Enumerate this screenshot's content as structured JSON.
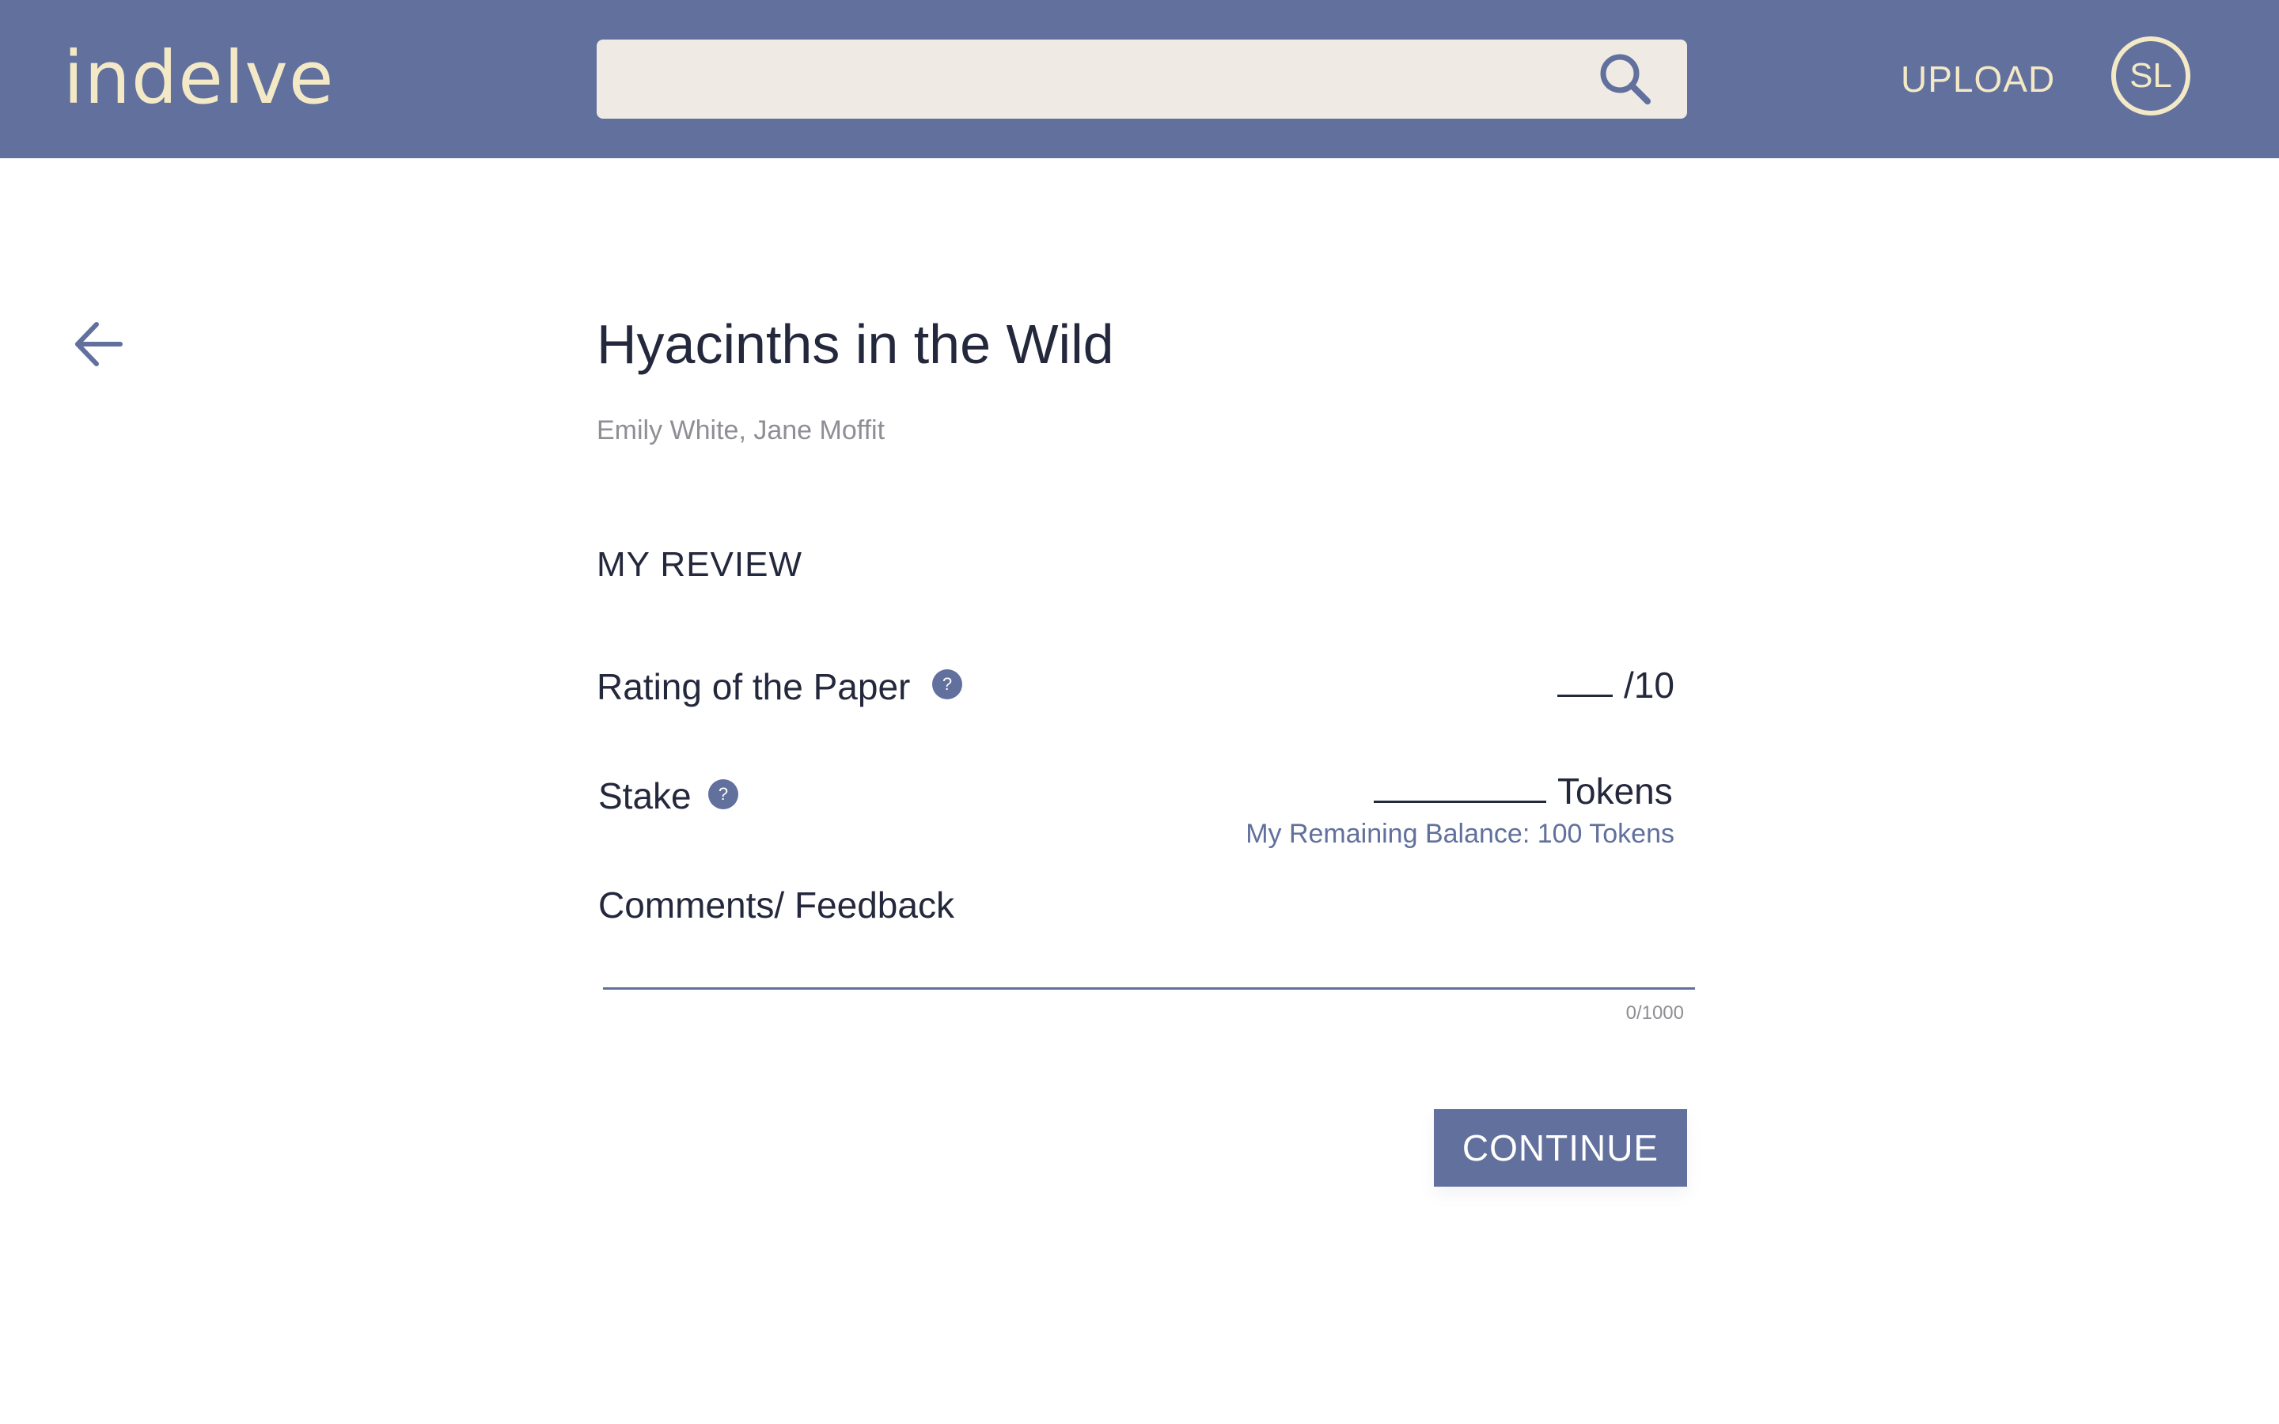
{
  "header": {
    "logo_text": "indelve",
    "search": {
      "value": "",
      "placeholder": "",
      "icon": "search-icon"
    },
    "upload_label": "UPLOAD",
    "avatar_initials": "SL"
  },
  "colors": {
    "brand": "#61709C",
    "logo_text": "#F3E9C6",
    "search_background": "#EFEBE4",
    "title_text": "#24283C",
    "muted_text": "#8E8E94"
  },
  "navigation": {
    "back_icon": "arrow-left-icon"
  },
  "paper": {
    "title": "Hyacinths in the Wild",
    "authors": "Emily White, Jane Moffit"
  },
  "review": {
    "heading": "MY REVIEW",
    "rating": {
      "label": "Rating of the Paper",
      "help_glyph": "?",
      "value": "",
      "max_text": "/10"
    },
    "stake": {
      "label": "Stake",
      "help_glyph": "?",
      "value": "",
      "unit": "Tokens",
      "balance_text": "My Remaining Balance: 100 Tokens"
    },
    "comments": {
      "label": "Comments/ Feedback",
      "value": "",
      "counter": "0/1000"
    },
    "continue_label": "CONTINUE"
  }
}
